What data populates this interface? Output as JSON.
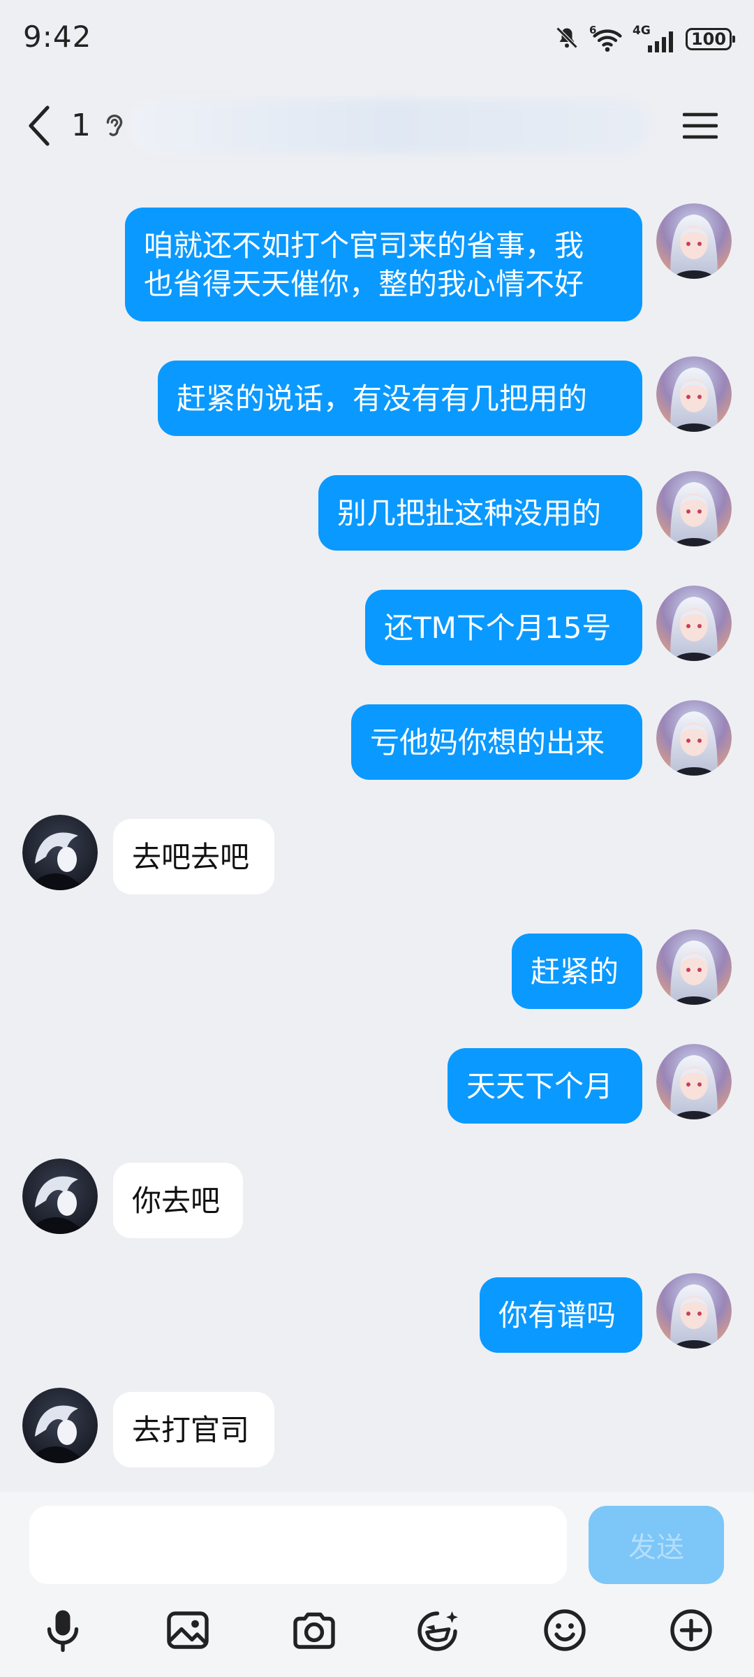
{
  "status_bar": {
    "time": "9:42",
    "network_sup": "6",
    "cell_label": "4G",
    "battery": "100",
    "icons": [
      "bell-muted-icon",
      "wifi-icon",
      "cell-signal-icon",
      "battery-icon"
    ]
  },
  "header": {
    "unread_count": "1",
    "icons": [
      "back-chevron-icon",
      "ear-icon",
      "menu-icon"
    ]
  },
  "messages": [
    {
      "side": "out",
      "text": "咱就还不如打个官司来的省事，我\n也省得天天催你，整的我心情不好"
    },
    {
      "side": "out",
      "text": "赶紧的说话，有没有有几把用的"
    },
    {
      "side": "out",
      "text": "别几把扯这种没用的"
    },
    {
      "side": "out",
      "text": "还TM下个月15号"
    },
    {
      "side": "out",
      "text": "亏他妈你想的出来"
    },
    {
      "side": "in",
      "text": "去吧去吧"
    },
    {
      "side": "out",
      "text": "赶紧的"
    },
    {
      "side": "out",
      "text": "天天下个月"
    },
    {
      "side": "in",
      "text": "你去吧"
    },
    {
      "side": "out",
      "text": "你有谱吗"
    },
    {
      "side": "in",
      "text": "去打官司"
    }
  ],
  "composer": {
    "input_value": "",
    "send_label": "发送"
  },
  "toolbar": {
    "icons": [
      "microphone-icon",
      "image-icon",
      "camera-icon",
      "emoji-edit-icon",
      "smiley-icon",
      "plus-icon"
    ]
  },
  "colors": {
    "outgoing_bubble": "#0A99FF",
    "incoming_bubble": "#FFFFFF",
    "background": "#EEEFF3",
    "send_disabled": "#7CC6F8"
  }
}
